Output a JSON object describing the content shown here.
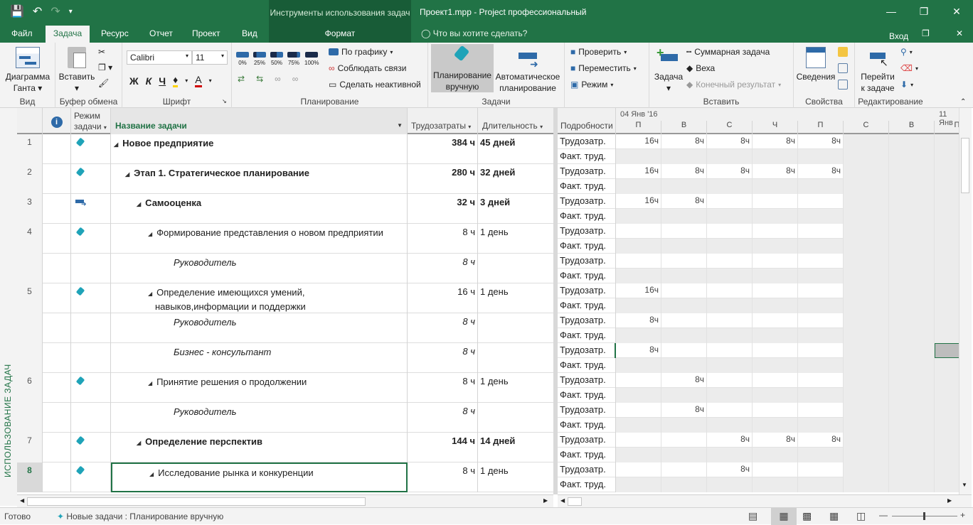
{
  "title_bar": {
    "context_title": "Инструменты использования задач",
    "doc_title": "Проект1.mpp - Project профессиональный"
  },
  "tabs": {
    "file": "Файл",
    "task": "Задача",
    "resource": "Ресурс",
    "report": "Отчет",
    "project": "Проект",
    "view": "Вид",
    "format": "Формат",
    "search": "Что вы хотите сделать?",
    "login": "Вход"
  },
  "ribbon": {
    "gantt_line1": "Диаграмма",
    "gantt_line2": "Ганта",
    "paste": "Вставить",
    "font_name": "Calibri",
    "font_size": "11",
    "bold": "Ж",
    "italic": "К",
    "underline": "Ч",
    "pct0": "0%",
    "pct25": "25%",
    "pct50": "50%",
    "pct75": "75%",
    "pct100": "100%",
    "on_schedule": "По графику",
    "respect_links": "Соблюдать связи",
    "inactivate": "Сделать неактивной",
    "manual_line1": "Планирование",
    "manual_line2": "вручную",
    "auto_line1": "Автоматическое",
    "auto_line2": "планирование",
    "inspect": "Проверить",
    "move": "Переместить",
    "mode": "Режим",
    "task_btn": "Задача",
    "summary": "Суммарная задача",
    "milestone": "Веха",
    "deliverable": "Конечный результат",
    "info": "Сведения",
    "goto_line1": "Перейти",
    "goto_line2": "к задаче",
    "g_view": "Вид",
    "g_clipboard": "Буфер обмена",
    "g_font": "Шрифт",
    "g_schedule": "Планирование",
    "g_tasks": "Задачи",
    "g_insert": "Вставить",
    "g_properties": "Свойства",
    "g_editing": "Редактирование"
  },
  "side_label": "ИСПОЛЬЗОВАНИЕ ЗАДАЧ",
  "columns": {
    "mode_line1": "Режим",
    "mode_line2": "задачи",
    "name": "Название задачи",
    "work": "Трудозатраты",
    "duration": "Длительность"
  },
  "rows": [
    {
      "id": "1",
      "name": "Новое предприятие",
      "work": "384 ч",
      "duration": "45 дней"
    },
    {
      "id": "2",
      "name": "Этап 1. Стратегическое планирование",
      "work": "280 ч",
      "duration": "32 дней"
    },
    {
      "id": "3",
      "name": "Самооценка",
      "work": "32 ч",
      "duration": "3 дней"
    },
    {
      "id": "4",
      "name": "Формирование представления о новом предприятии",
      "work": "8 ч",
      "duration": "1 день"
    },
    {
      "id": "",
      "name": "Руководитель",
      "work": "8 ч",
      "duration": ""
    },
    {
      "id": "5",
      "name": "Определение имеющихся умений,",
      "name2": "навыков,информации и поддержки",
      "work": "16 ч",
      "duration": "1 день"
    },
    {
      "id": "",
      "name": "Руководитель",
      "work": "8 ч",
      "duration": ""
    },
    {
      "id": "",
      "name": "Бизнес - консультант",
      "work": "8 ч",
      "duration": ""
    },
    {
      "id": "6",
      "name": "Принятие решения о продолжении",
      "work": "8 ч",
      "duration": "1 день"
    },
    {
      "id": "",
      "name": "Руководитель",
      "work": "8 ч",
      "duration": ""
    },
    {
      "id": "7",
      "name": "Определение перспектив",
      "work": "144 ч",
      "duration": "14 дней"
    },
    {
      "id": "8",
      "name": "Исследование рынка и конкуренции",
      "work": "8 ч",
      "duration": "1 день"
    }
  ],
  "timescale": {
    "details_header": "Подробности",
    "week1": "04 Янв '16",
    "week2": "11 Янв",
    "days": [
      "П",
      "В",
      "С",
      "Ч",
      "П",
      "С",
      "В",
      "П"
    ],
    "work_label": "Трудозатр.",
    "actual_label": "Факт. труд.",
    "values": [
      [
        "16ч",
        "8ч",
        "8ч",
        "8ч",
        "8ч"
      ],
      [
        "16ч",
        "8ч",
        "8ч",
        "8ч",
        "8ч"
      ],
      [
        "16ч",
        "8ч",
        "",
        "",
        ""
      ],
      [
        "",
        "",
        "",
        "",
        ""
      ],
      [
        "",
        "",
        "",
        "",
        ""
      ],
      [
        "16ч",
        "",
        "",
        "",
        ""
      ],
      [
        "8ч",
        "",
        "",
        "",
        ""
      ],
      [
        "8ч",
        "",
        "",
        "",
        ""
      ],
      [
        "",
        "8ч",
        "",
        "",
        ""
      ],
      [
        "",
        "8ч",
        "",
        "",
        ""
      ],
      [
        "",
        "",
        "8ч",
        "8ч",
        "8ч"
      ],
      [
        "",
        "",
        "8ч",
        "",
        ""
      ]
    ]
  },
  "status": {
    "ready": "Готово",
    "new_tasks": "Новые задачи : Планирование вручную"
  }
}
